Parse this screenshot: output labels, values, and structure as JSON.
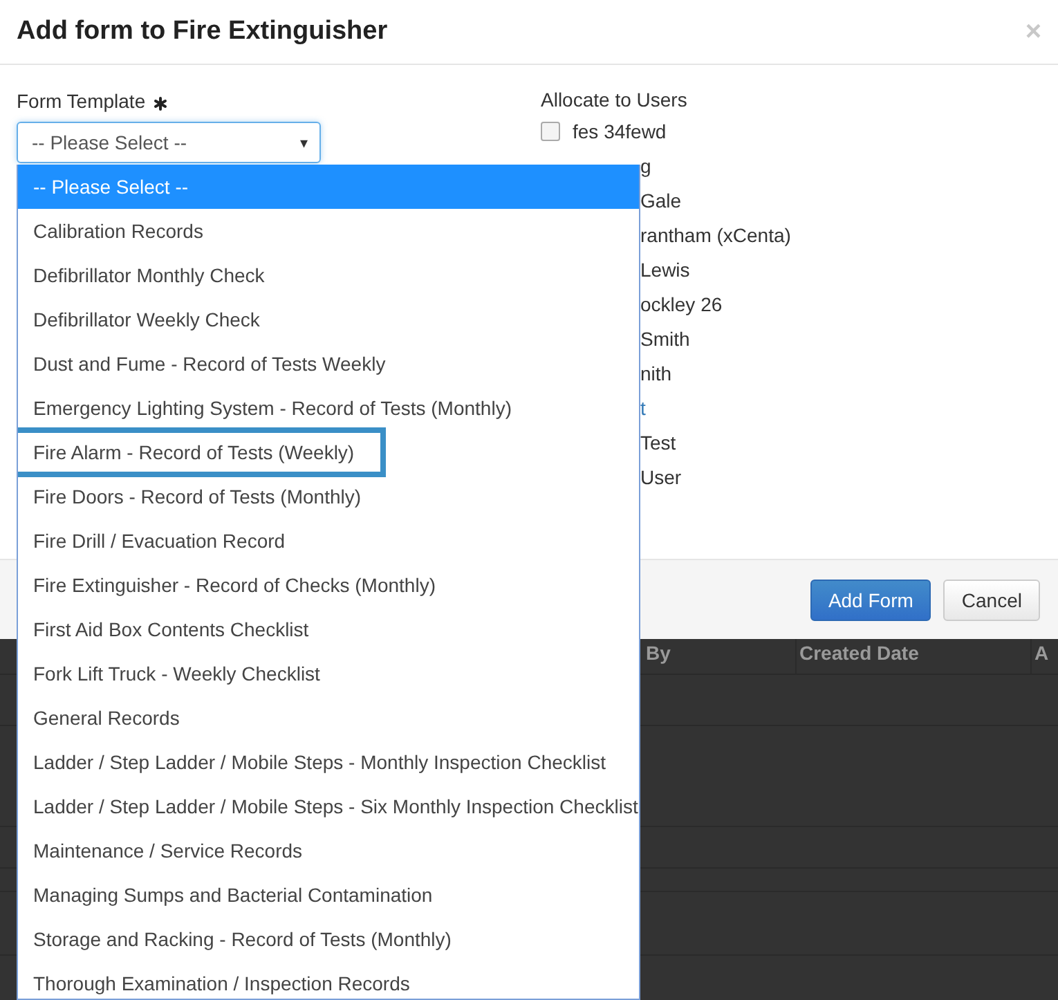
{
  "modal": {
    "title": "Add form to Fire Extinguisher",
    "close": "×"
  },
  "form_template": {
    "label": "Form Template",
    "required": true,
    "value": "-- Please Select --",
    "caret": "▾"
  },
  "allocate": {
    "label": "Allocate to Users",
    "users": [
      {
        "name": "fes 34fewd",
        "checked": false,
        "covered": false
      },
      {
        "name": "g",
        "covered": true
      },
      {
        "name": "Gale",
        "covered": true
      },
      {
        "name": "rantham (xCenta)",
        "covered": true
      },
      {
        "name": "Lewis",
        "covered": true
      },
      {
        "name": "ockley 26",
        "covered": true
      },
      {
        "name": "Smith",
        "covered": true
      },
      {
        "name": "nith",
        "covered": true
      },
      {
        "name": "t",
        "covered": true,
        "kind": "link"
      },
      {
        "name": "Test",
        "covered": true
      },
      {
        "name": "User",
        "covered": true
      }
    ]
  },
  "buttons": [
    {
      "label": "Add Form",
      "kind": "primary"
    },
    {
      "label": "Cancel",
      "kind": "default"
    }
  ],
  "background_table": {
    "columns": [
      "By",
      "Created Date",
      "A"
    ]
  },
  "dropdown": {
    "options": [
      {
        "label": "-- Please Select --",
        "selected": true,
        "outlined": false
      },
      {
        "label": "Calibration Records",
        "selected": false,
        "outlined": false
      },
      {
        "label": "Defibrillator Monthly Check",
        "selected": false,
        "outlined": false
      },
      {
        "label": "Defibrillator Weekly Check",
        "selected": false,
        "outlined": false
      },
      {
        "label": "Dust and Fume - Record of Tests Weekly",
        "selected": false,
        "outlined": false
      },
      {
        "label": "Emergency Lighting System - Record of Tests (Monthly)",
        "selected": false,
        "outlined": false
      },
      {
        "label": "Fire Alarm - Record of Tests (Weekly)",
        "selected": false,
        "outlined": true
      },
      {
        "label": "Fire Doors - Record of Tests (Monthly)",
        "selected": false,
        "outlined": false
      },
      {
        "label": "Fire Drill / Evacuation Record",
        "selected": false,
        "outlined": false
      },
      {
        "label": "Fire Extinguisher - Record of Checks (Monthly)",
        "selected": false,
        "outlined": false
      },
      {
        "label": "First Aid Box Contents Checklist",
        "selected": false,
        "outlined": false
      },
      {
        "label": "Fork Lift Truck - Weekly Checklist",
        "selected": false,
        "outlined": false
      },
      {
        "label": "General Records",
        "selected": false,
        "outlined": false
      },
      {
        "label": "Ladder / Step Ladder / Mobile Steps - Monthly Inspection Checklist",
        "selected": false,
        "outlined": false
      },
      {
        "label": "Ladder / Step Ladder / Mobile Steps - Six Monthly Inspection Checklist",
        "selected": false,
        "outlined": false
      },
      {
        "label": "Maintenance / Service Records",
        "selected": false,
        "outlined": false
      },
      {
        "label": "Managing Sumps and Bacterial Contamination",
        "selected": false,
        "outlined": false
      },
      {
        "label": "Storage and Racking - Record of Tests (Monthly)",
        "selected": false,
        "outlined": false
      },
      {
        "label": "Thorough Examination / Inspection Records",
        "selected": false,
        "outlined": false
      }
    ]
  }
}
